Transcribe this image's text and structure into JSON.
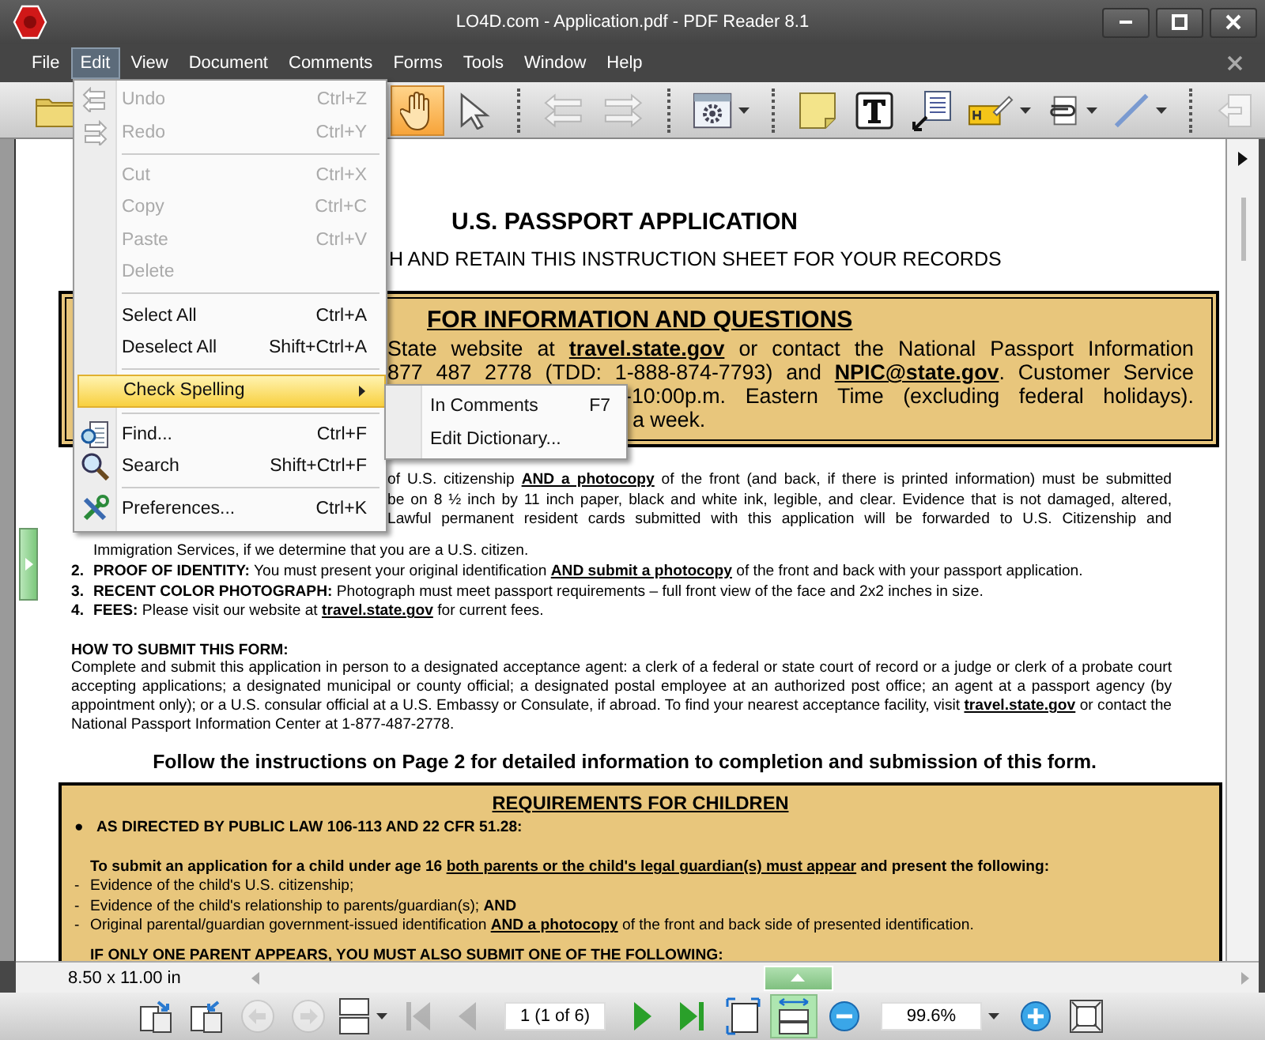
{
  "window": {
    "title": "LO4D.com - Application.pdf - PDF Reader 8.1"
  },
  "menu_bar": [
    {
      "label": "File",
      "selected": false
    },
    {
      "label": "Edit",
      "selected": true
    },
    {
      "label": "View",
      "selected": false
    },
    {
      "label": "Document",
      "selected": false
    },
    {
      "label": "Comments",
      "selected": false
    },
    {
      "label": "Forms",
      "selected": false
    },
    {
      "label": "Tools",
      "selected": false
    },
    {
      "label": "Window",
      "selected": false
    },
    {
      "label": "Help",
      "selected": false
    }
  ],
  "toolbar": [
    {
      "selected": false,
      "disabled": false,
      "dropdown": false
    },
    {
      "selected": true,
      "disabled": false,
      "dropdown": false
    },
    {
      "selected": false,
      "disabled": false,
      "dropdown": false
    },
    {
      "selected": false,
      "disabled": true,
      "dropdown": false
    },
    {
      "selected": false,
      "disabled": true,
      "dropdown": false
    },
    {
      "selected": false,
      "disabled": false,
      "dropdown": true
    },
    {
      "selected": false,
      "disabled": false,
      "dropdown": false
    },
    {
      "selected": false,
      "disabled": false,
      "dropdown": false
    },
    {
      "selected": false,
      "disabled": false,
      "dropdown": false
    },
    {
      "selected": false,
      "disabled": false,
      "dropdown": true
    },
    {
      "selected": false,
      "disabled": false,
      "dropdown": true
    },
    {
      "selected": false,
      "disabled": false,
      "dropdown": true
    },
    {
      "selected": false,
      "disabled": true,
      "dropdown": false
    }
  ],
  "edit_menu": [
    {
      "kind": "item",
      "label": "Undo",
      "shortcut": "Ctrl+Z",
      "disabled": true
    },
    {
      "kind": "item",
      "label": "Redo",
      "shortcut": "Ctrl+Y",
      "disabled": true
    },
    {
      "kind": "separator"
    },
    {
      "kind": "item",
      "label": "Cut",
      "shortcut": "Ctrl+X",
      "disabled": true
    },
    {
      "kind": "item",
      "label": "Copy",
      "shortcut": "Ctrl+C",
      "disabled": true
    },
    {
      "kind": "item",
      "label": "Paste",
      "shortcut": "Ctrl+V",
      "disabled": true
    },
    {
      "kind": "item",
      "label": "Delete",
      "disabled": true
    },
    {
      "kind": "separator"
    },
    {
      "kind": "item",
      "label": "Select All",
      "shortcut": "Ctrl+A",
      "disabled": false
    },
    {
      "kind": "item",
      "label": "Deselect All",
      "shortcut": "Shift+Ctrl+A",
      "disabled": false
    },
    {
      "kind": "separator"
    },
    {
      "kind": "submenu",
      "label": "Check Spelling",
      "selected": true,
      "disabled": false,
      "items": [
        {
          "label": "In Comments",
          "shortcut": "F7"
        },
        {
          "label": "Edit Dictionary..."
        }
      ]
    },
    {
      "kind": "separator"
    },
    {
      "kind": "item",
      "label": "Find...",
      "shortcut": "Ctrl+F",
      "disabled": false
    },
    {
      "kind": "item",
      "label": "Search",
      "shortcut": "Shift+Ctrl+F",
      "disabled": false
    },
    {
      "kind": "separator"
    },
    {
      "kind": "item",
      "label": "Preferences...",
      "shortcut": "Ctrl+K",
      "disabled": false
    }
  ],
  "document": {
    "title": "U.S. PASSPORT APPLICATION",
    "subtitle": "H AND RETAIN THIS INSTRUCTION SHEET FOR YOUR RECORDS",
    "info_box": {
      "heading": "FOR INFORMATION AND QUESTIONS",
      "lines": [
        "State website at *travel.state.gov* or contact the National Passport Information",
        "877 487 2778 (TDD: 1-888-874-7793) and *NPIC@state.gov*.  Customer Service",
        "-10:00p.m. Eastern Time (excluding federal holidays).",
        "a week."
      ]
    },
    "item_1_lines": [
      "of U.S. citizenship *AND a photocopy* of the front (and back, if there is printed information) must be submitted",
      "be on 8 ½ inch by 11 inch paper, black and white ink, legible, and clear. Evidence that is not damaged, altered,",
      "Lawful permanent resident cards submitted with this application will be forwarded to U.S. Citizenship and",
      "Immigration Services, if we determine that you are a U.S. citizen."
    ],
    "items": [
      {
        "number": "2.",
        "text": "**PROOF OF IDENTITY:** You must present your original identification *AND submit a photocopy* of the front and back with your passport application."
      },
      {
        "number": "3.",
        "text": "**RECENT COLOR PHOTOGRAPH:** Photograph must meet passport requirements – full front view of the face and 2x2 inches in size."
      },
      {
        "number": "4.",
        "text": "**FEES:** Please visit our website at *travel.state.gov* for current fees."
      }
    ],
    "how_to": {
      "heading": "HOW TO SUBMIT THIS FORM:",
      "text": "Complete and submit this application in person to a designated acceptance agent:  a clerk of a federal or state court of record or a judge or clerk of a probate court accepting applications; a designated municipal or county official; a designated postal employee at an authorized post office; an agent at a passport agency (by appointment only); or a U.S. consular official at a U.S. Embassy or Consulate, if abroad.  To find your nearest acceptance facility, visit *travel.state.gov* or contact the National Passport Information Center at 1-877-487-2778."
    },
    "follow": "Follow the instructions on Page 2 for detailed information to completion and submission of this form.",
    "requirements": {
      "heading": "REQUIREMENTS FOR CHILDREN",
      "bullet": "●",
      "law": "AS DIRECTED BY PUBLIC LAW 106-113 AND 22 CFR 51.28:",
      "intro": "To submit an application for a child under age 16 *both parents or the child's legal guardian(s) must appear* and present the following:",
      "items": [
        {
          "marker": "-",
          "text": "Evidence of the child's U.S. citizenship;"
        },
        {
          "marker": "-",
          "text": "Evidence of the child's relationship to parents/guardian(s); **AND**"
        },
        {
          "marker": "-",
          "text": "Original parental/guardian government-issued identification *AND a photocopy* of the front and back side of presented identification."
        }
      ],
      "last": "IF ONLY ONE PARENT APPEARS, YOU MUST ALSO SUBMIT ONE OF THE FOLLOWING:"
    }
  },
  "status": {
    "page_size": "8.50 x 11.00 in"
  },
  "nav_bar": [
    {
      "kind": "button",
      "selected": false,
      "disabled": false,
      "dropdown": false
    },
    {
      "kind": "button",
      "selected": false,
      "disabled": false,
      "dropdown": false
    },
    {
      "kind": "button",
      "selected": false,
      "disabled": true,
      "dropdown": false
    },
    {
      "kind": "button",
      "selected": false,
      "disabled": true,
      "dropdown": false
    },
    {
      "kind": "button",
      "selected": false,
      "disabled": false,
      "dropdown": true
    },
    {
      "kind": "button",
      "selected": false,
      "disabled": true,
      "dropdown": false
    },
    {
      "kind": "button",
      "selected": false,
      "disabled": true,
      "dropdown": false
    },
    {
      "kind": "field",
      "value": "1 (1 of 6)"
    },
    {
      "kind": "button",
      "selected": false,
      "disabled": false,
      "dropdown": false
    },
    {
      "kind": "button",
      "selected": false,
      "disabled": false,
      "dropdown": false
    },
    {
      "kind": "button",
      "selected": false,
      "disabled": false,
      "dropdown": false
    },
    {
      "kind": "button",
      "selected": true,
      "disabled": false,
      "dropdown": false
    },
    {
      "kind": "button",
      "selected": false,
      "disabled": false,
      "dropdown": false
    },
    {
      "kind": "field",
      "value": "99.6%",
      "dropdown": true
    },
    {
      "kind": "button",
      "selected": false,
      "disabled": false,
      "dropdown": false
    },
    {
      "kind": "button",
      "selected": false,
      "disabled": false,
      "dropdown": false
    }
  ]
}
